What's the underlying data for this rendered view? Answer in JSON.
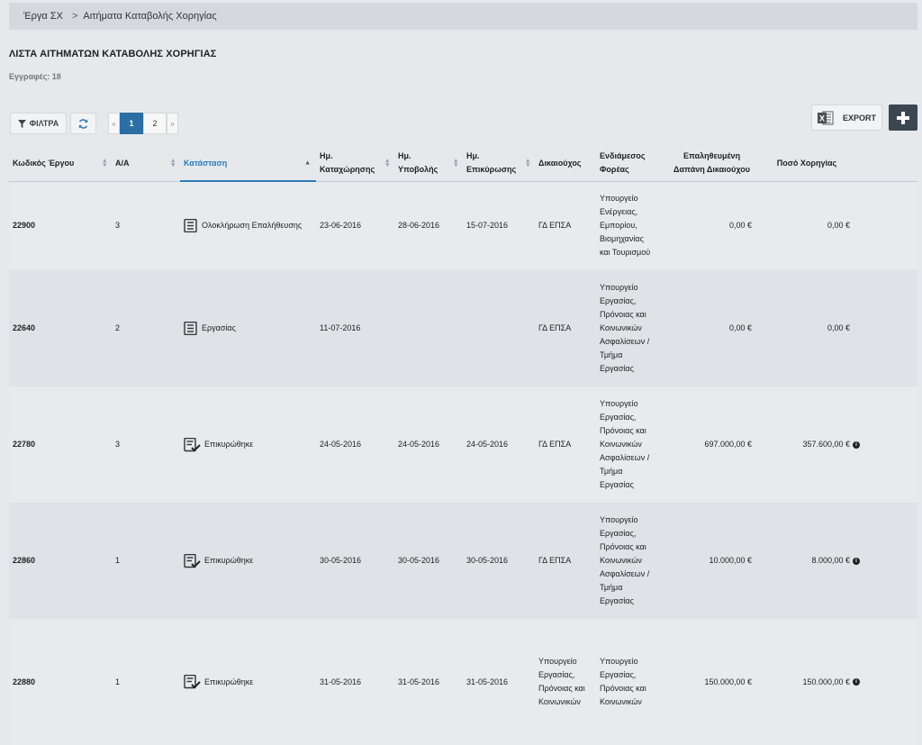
{
  "breadcrumb": {
    "item1": "Έργα ΣΧ",
    "separator": ">",
    "item2": "Αιτήματα Καταβολής Χορηγίας"
  },
  "page_title": "ΛΙΣΤΑ ΑΙΤΗΜΑΤΩΝ ΚΑΤΑΒΟΛΗΣ ΧΟΡΗΓΙΑΣ",
  "records": "Εγγραφές: 18",
  "toolbar": {
    "filters_label": "ΦΙΛΤΡΑ",
    "export_label": "EXPORT",
    "export_icon_letter": "X"
  },
  "pagination": {
    "prev": "«",
    "pages": [
      "1",
      "2"
    ],
    "next": "»",
    "current": "1"
  },
  "columns": {
    "code": "Κωδικός Έργου",
    "aa": "Α/Α",
    "status": "Κατάσταση",
    "reg_date_1": "Ημ.",
    "reg_date_2": "Καταχώρησης",
    "sub_date_1": "Ημ.",
    "sub_date_2": "Υποβολής",
    "val_date_1": "Ημ.",
    "val_date_2": "Επικύρωσης",
    "beneficiary": "Δικαιούχος",
    "intermediate_1": "Ενδιάμεσος",
    "intermediate_2": "Φορέας",
    "verified_1": "Επαληθευμένη",
    "verified_2": "Δαπάνη Δικαιούχου",
    "grant": "Ποσό Χορηγίας"
  },
  "rows": [
    {
      "code": "22900",
      "aa": "3",
      "status": "Ολοκλήρωση Επαλήθευσης",
      "status_icon": "document-icon",
      "reg_date": "23-06-2016",
      "sub_date": "28-06-2016",
      "val_date": "15-07-2016",
      "beneficiary": "ΓΔ ΕΠΣΑ",
      "intermediate": "Υπουργείο Ενέργειας, Εμπορίου, Βιομηχανίας και Τουρισμού",
      "verified": "0,00 €",
      "grant": "0,00 €",
      "info": false
    },
    {
      "code": "22640",
      "aa": "2",
      "status": "Εργασίας",
      "status_icon": "document-icon",
      "reg_date": "11-07-2016",
      "sub_date": "",
      "val_date": "",
      "beneficiary": "ΓΔ ΕΠΣΑ",
      "intermediate": "Υπουργείο Εργασίας, Πρόνοιας και Κοινωνικών Ασφαλίσεων / Τμήμα Εργασίας",
      "verified": "0,00 €",
      "grant": "0,00 €",
      "info": false
    },
    {
      "code": "22780",
      "aa": "3",
      "status": "Επικυρώθηκε",
      "status_icon": "document-check-icon",
      "reg_date": "24-05-2016",
      "sub_date": "24-05-2016",
      "val_date": "24-05-2016",
      "beneficiary": "ΓΔ ΕΠΣΑ",
      "intermediate": "Υπουργείο Εργασίας, Πρόνοιας και Κοινωνικών Ασφαλίσεων / Τμήμα Εργασίας",
      "verified": "697.000,00 €",
      "grant": "357.600,00 €",
      "info": true
    },
    {
      "code": "22860",
      "aa": "1",
      "status": "Επικυρώθηκε",
      "status_icon": "document-check-icon",
      "reg_date": "30-05-2016",
      "sub_date": "30-05-2016",
      "val_date": "30-05-2016",
      "beneficiary": "ΓΔ ΕΠΣΑ",
      "intermediate": "Υπουργείο Εργασίας, Πρόνοιας και Κοινωνικών Ασφαλίσεων / Τμήμα Εργασίας",
      "verified": "10.000,00 €",
      "grant": "8.000,00 €",
      "info": true
    },
    {
      "code": "22880",
      "aa": "1",
      "status": "Επικυρώθηκε",
      "status_icon": "document-check-icon",
      "reg_date": "31-05-2016",
      "sub_date": "31-05-2016",
      "val_date": "31-05-2016",
      "beneficiary": "Υπουργείο Εργασίας, Πρόνοιας και Κοινωνικών",
      "intermediate": "Υπουργείο Εργασίας, Πρόνοιας και Κοινωνικών",
      "verified": "150.000,00 €",
      "grant": "150.000,00 €",
      "info": true
    }
  ],
  "colors": {
    "accent": "#2a6ea5",
    "sorted_header": "#2a7bb8",
    "add_button": "#3c4650"
  }
}
